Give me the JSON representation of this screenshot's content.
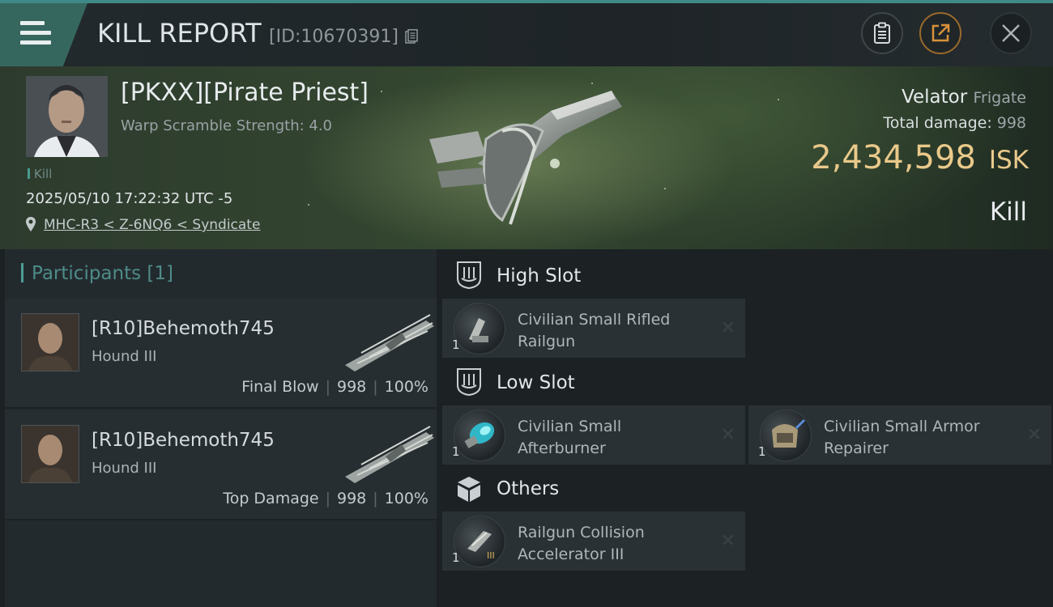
{
  "header": {
    "title": "KILL REPORT",
    "id_label": "[ID:10670391]"
  },
  "victim": {
    "name": "[PKXX][Pirate Priest]",
    "warp_scramble": "Warp Scramble Strength: 4.0",
    "type_tag": "Kill",
    "datetime": "2025/05/10 17:22:32 UTC -5",
    "location": "MHC-R3 < Z-6NQ6 < Syndicate",
    "ship_name": "Velator",
    "ship_class": "Frigate",
    "total_damage_label": "Total damage:",
    "total_damage": "998",
    "isk_value": "2,434,598",
    "isk_unit": "ISK",
    "result": "Kill"
  },
  "participants": {
    "heading": "Participants [1]",
    "rows": [
      {
        "name": "[R10]Behemoth745",
        "ship": "Hound III",
        "role": "Final Blow",
        "damage": "998",
        "percent": "100%"
      },
      {
        "name": "[R10]Behemoth745",
        "ship": "Hound III",
        "role": "Top Damage",
        "damage": "998",
        "percent": "100%"
      }
    ]
  },
  "slots": {
    "high": {
      "label": "High Slot",
      "items": [
        {
          "line1": "Civilian Small Rifled",
          "line2": "Railgun",
          "qty": "1"
        }
      ]
    },
    "low": {
      "label": "Low Slot",
      "items": [
        {
          "line1": "Civilian Small",
          "line2": "Afterburner",
          "qty": "1"
        },
        {
          "line1": "Civilian Small Armor",
          "line2": "Repairer",
          "qty": "1"
        }
      ]
    },
    "others": {
      "label": "Others",
      "items": [
        {
          "line1": "Railgun Collision",
          "line2": "Accelerator III",
          "qty": "1"
        }
      ]
    }
  },
  "icons": {
    "menu": "hamburger-menu-icon",
    "copy": "copy-icon",
    "clipboard": "clipboard-icon",
    "share": "share-icon",
    "close": "close-icon",
    "location": "location-pin-icon"
  },
  "colors": {
    "accent_teal": "#4d8c88",
    "isk_gold": "#e9c98a",
    "share_orange": "#d9913a"
  }
}
